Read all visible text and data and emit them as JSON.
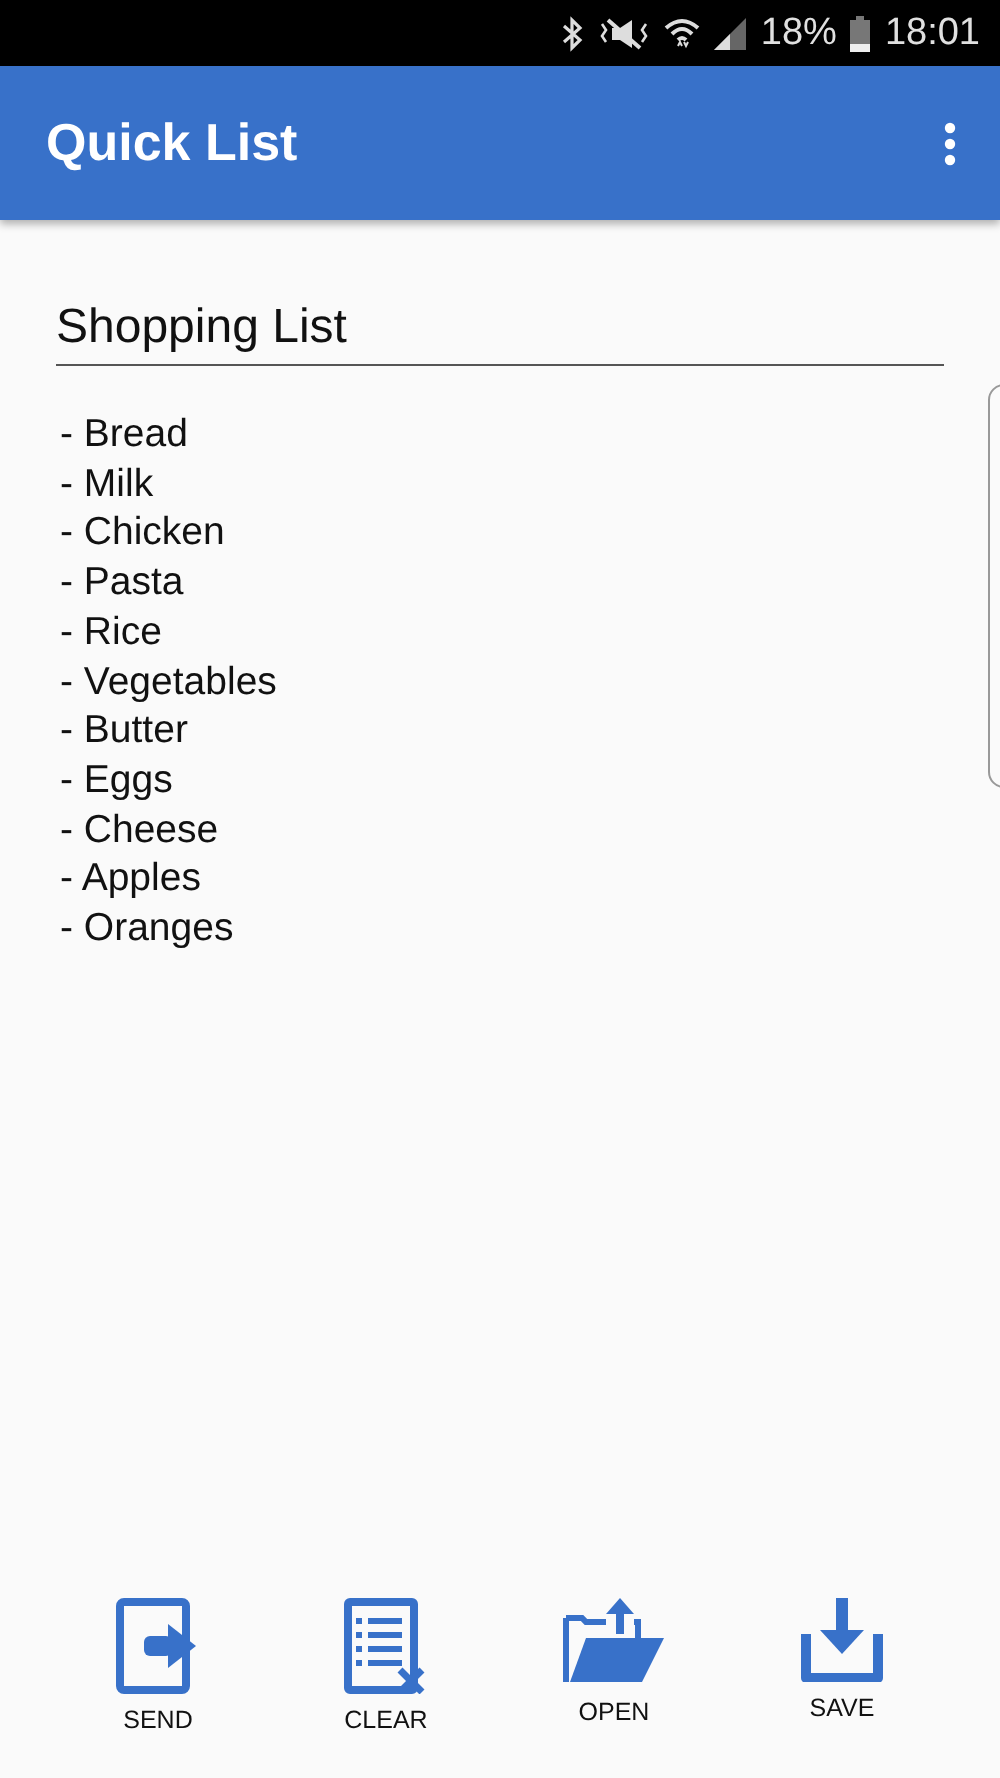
{
  "status_bar": {
    "battery": "18%",
    "time": "18:01"
  },
  "app_bar": {
    "title": "Quick List"
  },
  "list_title": {
    "value": "Shopping List"
  },
  "items": [
    "- Bread",
    "- Milk",
    "- Chicken",
    "- Pasta",
    "- Rice",
    "- Vegetables",
    "- Butter",
    "- Eggs",
    "- Cheese",
    "- Apples",
    "- Oranges"
  ],
  "actions": [
    {
      "kind": "send",
      "label": "SEND"
    },
    {
      "kind": "clear",
      "label": "CLEAR"
    },
    {
      "kind": "open",
      "label": "OPEN"
    },
    {
      "kind": "save",
      "label": "SAVE"
    }
  ]
}
